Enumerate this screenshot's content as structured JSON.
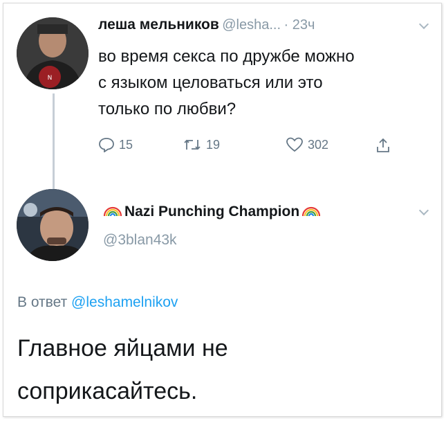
{
  "tweet1": {
    "name": "леша мельников",
    "handle": "@lesha...",
    "time": "· 23ч",
    "text_line1": "во время секса по дружбе можно",
    "text_line2": "с языком целоваться или это",
    "text_line3": "только по любви?",
    "actions": {
      "reply_count": "15",
      "retweet_count": "19",
      "like_count": "302"
    }
  },
  "tweet2": {
    "name": "Nazi Punching Champion",
    "handle": "@3blan43k",
    "reply_prefix": "В ответ",
    "reply_mention": "@leshamelnikov",
    "text_line1": "Главное яйцами не",
    "text_line2": "соприкасайтесь."
  },
  "colors": {
    "text": "#14171a",
    "muted": "#657786",
    "handle": "#8899a6",
    "link": "#1da1f2",
    "thread_line": "#c6ced6"
  },
  "icons": [
    "reply-icon",
    "retweet-icon",
    "like-icon",
    "share-icon",
    "rainbow-icon",
    "chevron-down-icon"
  ]
}
